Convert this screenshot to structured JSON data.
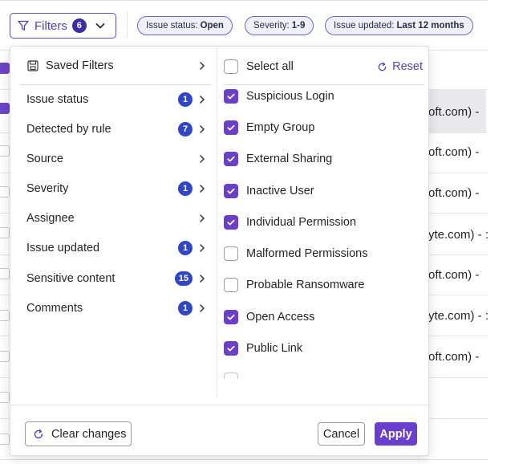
{
  "toolbar": {
    "filters_label": "Filters",
    "filters_count": "6"
  },
  "chips": [
    {
      "key": "Issue status:",
      "value": "Open"
    },
    {
      "key": "Severity:",
      "value": "1-9"
    },
    {
      "key": "Issue updated:",
      "value": "Last 12 months"
    }
  ],
  "background_rows": [
    "oft.com) -",
    "oft.com) -",
    "oft.com) -",
    "yte.com) - :",
    "oft.com) -",
    "yte.com) - :",
    "oft.com) -"
  ],
  "left_menu": {
    "saved_filters": "Saved Filters",
    "items": [
      {
        "label": "Issue status",
        "count": "1"
      },
      {
        "label": "Detected by rule",
        "count": "7"
      },
      {
        "label": "Source",
        "count": ""
      },
      {
        "label": "Severity",
        "count": "1"
      },
      {
        "label": "Assignee",
        "count": ""
      },
      {
        "label": "Issue updated",
        "count": "1"
      },
      {
        "label": "Sensitive content",
        "count": "15"
      },
      {
        "label": "Comments",
        "count": "1"
      }
    ]
  },
  "right_panel": {
    "select_all": "Select all",
    "reset": "Reset",
    "options": [
      {
        "label": "Suspicious Login",
        "checked": true
      },
      {
        "label": "Empty Group",
        "checked": true
      },
      {
        "label": "External Sharing",
        "checked": true
      },
      {
        "label": "Inactive User",
        "checked": true
      },
      {
        "label": "Individual Permission",
        "checked": true
      },
      {
        "label": "Malformed Permissions",
        "checked": false
      },
      {
        "label": "Probable Ransomware",
        "checked": false
      },
      {
        "label": "Open Access",
        "checked": true
      },
      {
        "label": "Public Link",
        "checked": true
      }
    ]
  },
  "footer": {
    "clear_changes": "Clear changes",
    "cancel": "Cancel",
    "apply": "Apply"
  },
  "colors": {
    "accent": "#6a40c8",
    "badge_blue": "#2f47c7",
    "chip_border": "#5b6ad0"
  }
}
